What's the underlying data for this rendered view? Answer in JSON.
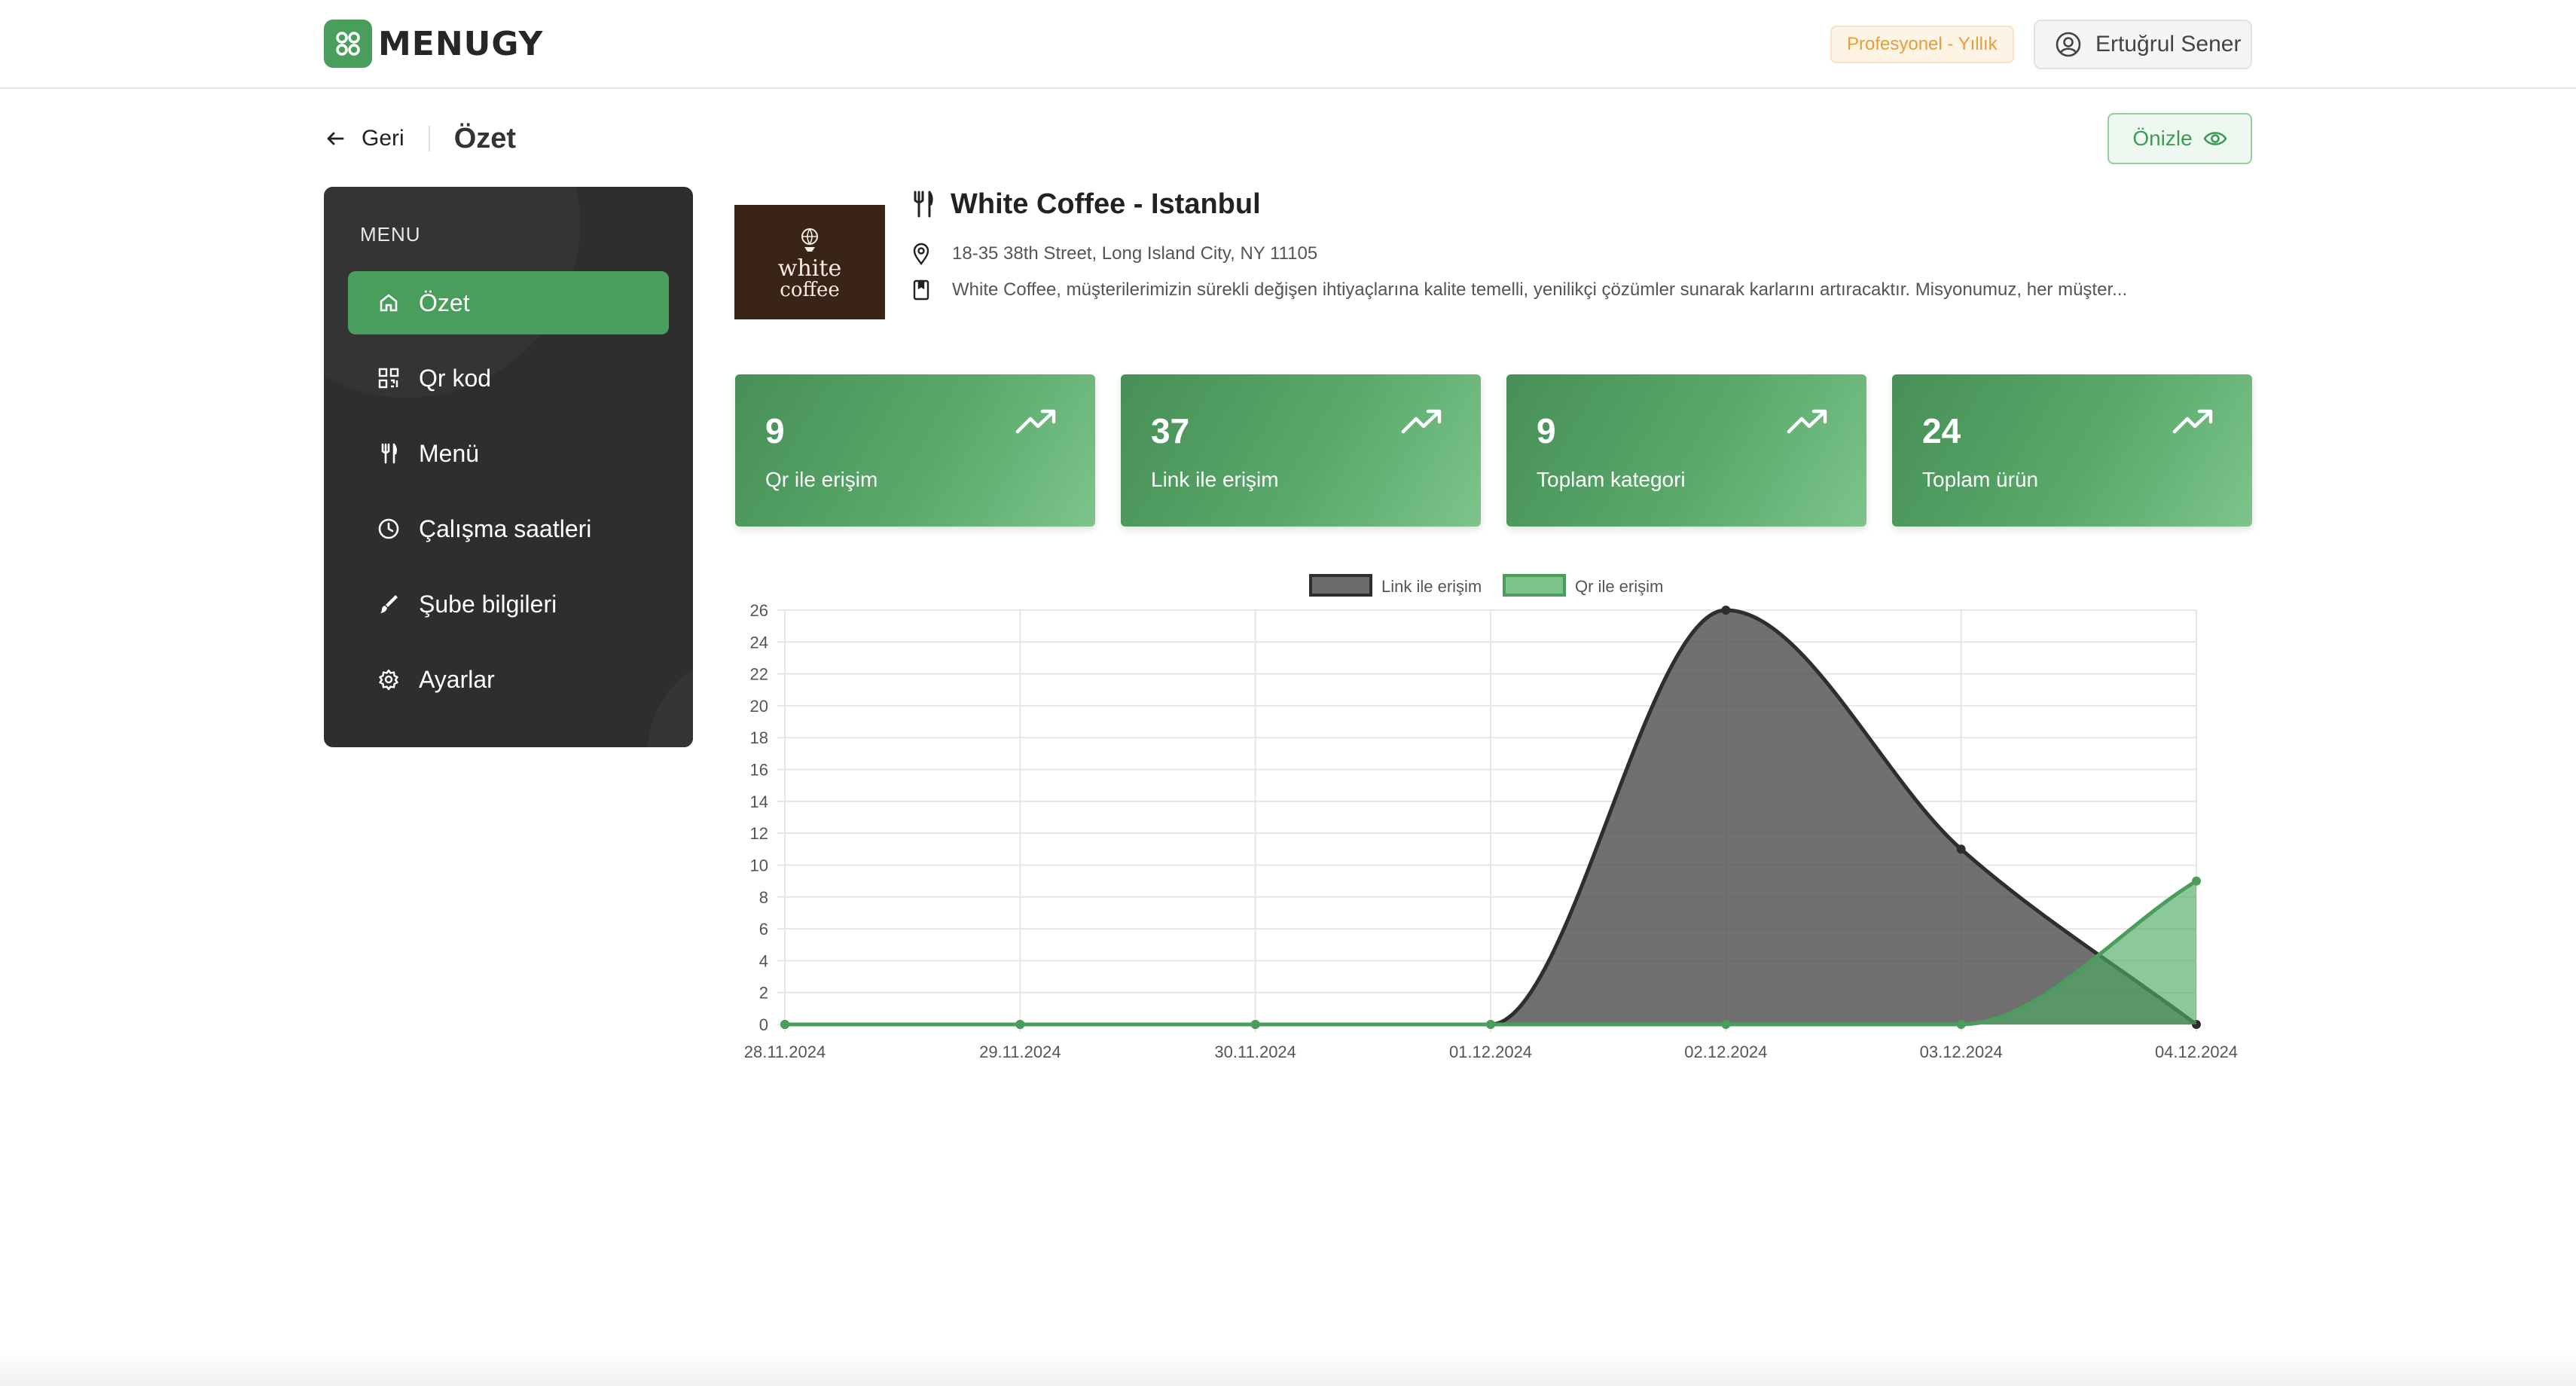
{
  "header": {
    "brand": "MENUGY",
    "plan_badge": "Profesyonel - Yıllık",
    "user_name": "Ertuğrul Sener"
  },
  "nav": {
    "back_label": "Geri",
    "page_title": "Özet",
    "preview_label": "Önizle"
  },
  "sidebar": {
    "section_label": "MENU",
    "items": [
      {
        "label": "Özet",
        "icon": "home-icon",
        "active": true
      },
      {
        "label": "Qr kod",
        "icon": "qr-code-icon",
        "active": false
      },
      {
        "label": "Menü",
        "icon": "fork-knife-icon",
        "active": false
      },
      {
        "label": "Çalışma saatleri",
        "icon": "clock-icon",
        "active": false
      },
      {
        "label": "Şube bilgileri",
        "icon": "brush-icon",
        "active": false
      },
      {
        "label": "Ayarlar",
        "icon": "gear-icon",
        "active": false
      }
    ]
  },
  "store": {
    "name": "White Coffee - Istanbul",
    "address": "18-35 38th Street, Long Island City, NY 11105",
    "description": "White Coffee, müşterilerimizin sürekli değişen ihtiyaçlarına kalite temelli, yenilikçi çözümler sunarak karlarını artıracaktır. Misyonumuz, her müşter...",
    "logo_text_1": "white",
    "logo_text_2": "coffee"
  },
  "stats": [
    {
      "value": "9",
      "label": "Qr ile erişim"
    },
    {
      "value": "37",
      "label": "Link ile erişim"
    },
    {
      "value": "9",
      "label": "Toplam kategori"
    },
    {
      "value": "24",
      "label": "Toplam ürün"
    }
  ],
  "colors": {
    "accent": "#4a9e5c",
    "sidebar_bg": "#2e2e2e",
    "link_series": "#6b6b6b",
    "qr_series": "#7cc48b"
  },
  "chart_data": {
    "type": "area",
    "x": [
      "28.11.2024",
      "29.11.2024",
      "30.11.2024",
      "01.12.2024",
      "02.12.2024",
      "03.12.2024",
      "04.12.2024"
    ],
    "series": [
      {
        "name": "Link ile erişim",
        "values": [
          0,
          0,
          0,
          0,
          26,
          11,
          0
        ],
        "color": "#6b6b6b"
      },
      {
        "name": "Qr ile erişim",
        "values": [
          0,
          0,
          0,
          0,
          0,
          0,
          9
        ],
        "color": "#7cc48b"
      }
    ],
    "yticks": [
      "0",
      "2",
      "4",
      "6",
      "8",
      "10",
      "12",
      "14",
      "16",
      "18",
      "20",
      "22",
      "24",
      "26"
    ],
    "ylim": [
      0,
      26
    ],
    "legend": "top-center",
    "grid": true
  }
}
